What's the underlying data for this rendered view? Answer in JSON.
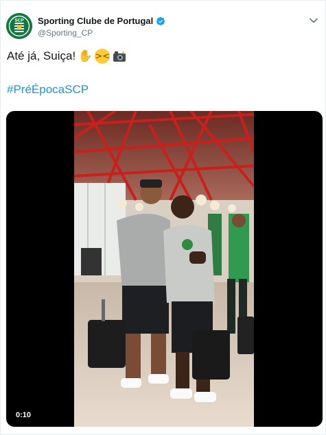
{
  "author": {
    "name": "Sporting Clube de Portugal",
    "handle": "@Sporting_CP",
    "verified": true,
    "avatar_icon": "sporting-cp-crest-icon",
    "avatar_text": "SCP"
  },
  "tweet": {
    "text": "Até já, Suiça!",
    "emojis": [
      "waving-hand-icon",
      "grinning-squinting-face-icon",
      "camera-with-flash-icon"
    ],
    "hashtag": "#PréÉpocaSCP"
  },
  "video": {
    "duration": "0:10"
  },
  "colors": {
    "link": "#1b95e0",
    "verified": "#1da1f2",
    "brand_green": "#0f7a3c",
    "handle_gray": "#657786"
  }
}
